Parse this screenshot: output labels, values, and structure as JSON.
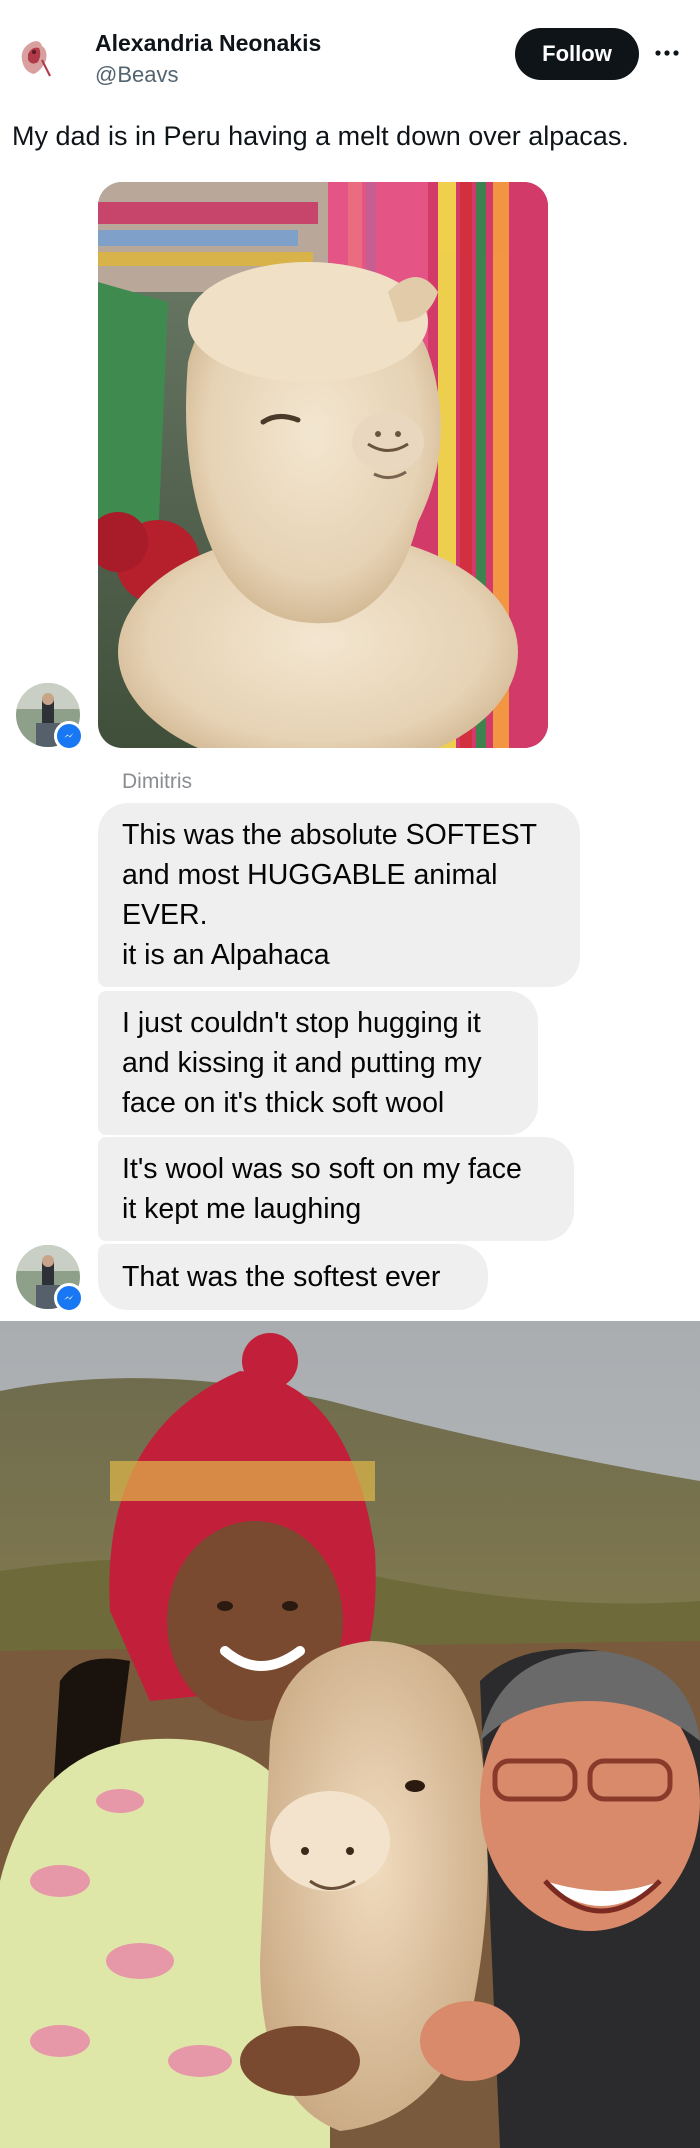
{
  "tweet": {
    "author_name": "Alexandria Neonakis",
    "author_handle": "@Beavs",
    "follow_label": "Follow",
    "text": "My dad is in Peru having a melt down over alpacas."
  },
  "chat": {
    "sender_name": "Dimitris",
    "messages": [
      "This was the absolute SOFTEST\nand most HUGGABLE animal\nEVER.\nit is an Alpahaca",
      "I just couldn't stop hugging it\nand kissing it and putting my\nface on it's thick soft wool",
      "It's wool was so soft on my face\nit kept me laughing",
      "That was the softest ever"
    ]
  },
  "icons": {
    "more": "more-horizontal-icon",
    "messenger": "messenger-badge-icon"
  },
  "colors": {
    "follow_bg": "#0f1419",
    "bubble_bg": "#efefef",
    "messenger_blue": "#1877f2",
    "handle_gray": "#536471"
  }
}
